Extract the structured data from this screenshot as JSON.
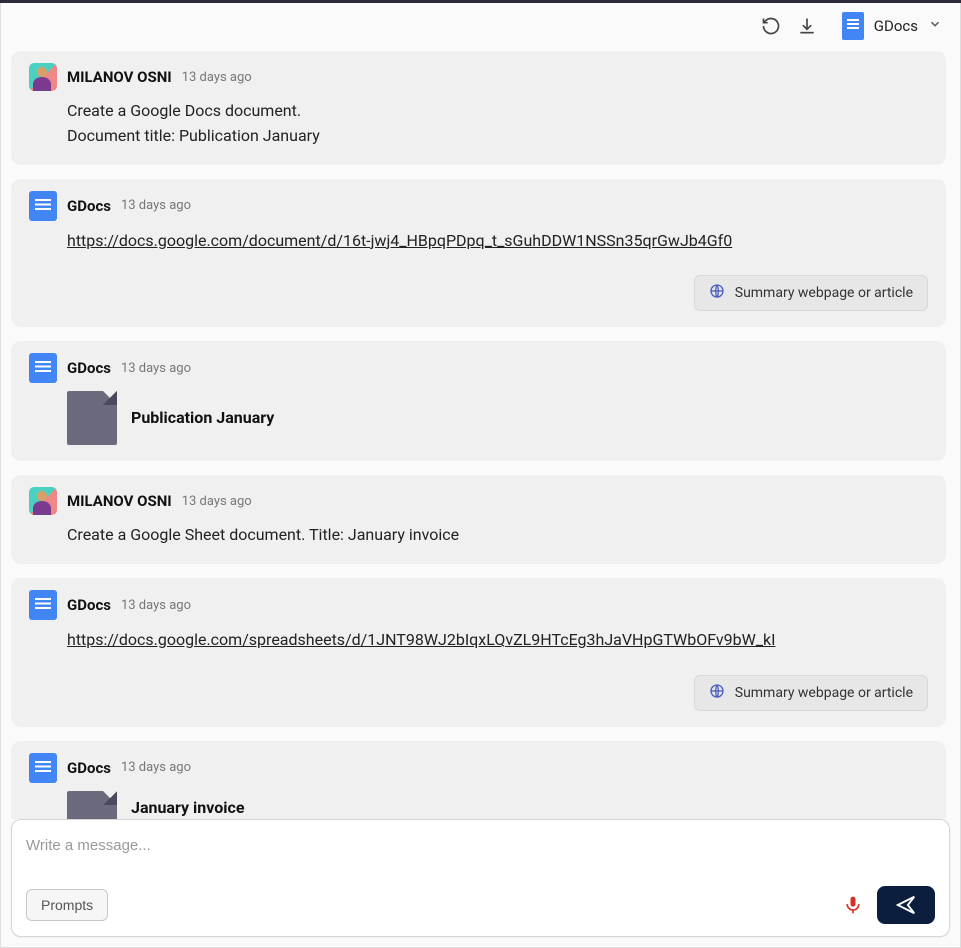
{
  "header": {
    "app_label": "GDocs"
  },
  "messages": [
    {
      "author": "MILANOV OSNI",
      "type": "user",
      "timestamp": "13 days ago",
      "lines": [
        "Create a Google Docs document.",
        "Document title: Publication January"
      ]
    },
    {
      "author": "GDocs",
      "type": "bot",
      "timestamp": "13 days ago",
      "link": "https://docs.google.com/document/d/16t-jwj4_HBpqPDpq_t_sGuhDDW1NSSn35qrGwJb4Gf0",
      "suggest": "Summary webpage or article"
    },
    {
      "author": "GDocs",
      "type": "bot-doc",
      "timestamp": "13 days ago",
      "doc_title": "Publication January"
    },
    {
      "author": "MILANOV OSNI",
      "type": "user",
      "timestamp": "13 days ago",
      "lines": [
        "Create a Google Sheet document. Title: January invoice"
      ]
    },
    {
      "author": "GDocs",
      "type": "bot",
      "timestamp": "13 days ago",
      "link": "https://docs.google.com/spreadsheets/d/1JNT98WJ2bIqxLQvZL9HTcEg3hJaVHpGTWbOFv9bW_kI",
      "suggest": "Summary webpage or article"
    },
    {
      "author": "GDocs",
      "type": "bot-doc",
      "timestamp": "13 days ago",
      "doc_title": "January invoice"
    }
  ],
  "composer": {
    "placeholder": "Write a message...",
    "prompts_label": "Prompts"
  }
}
